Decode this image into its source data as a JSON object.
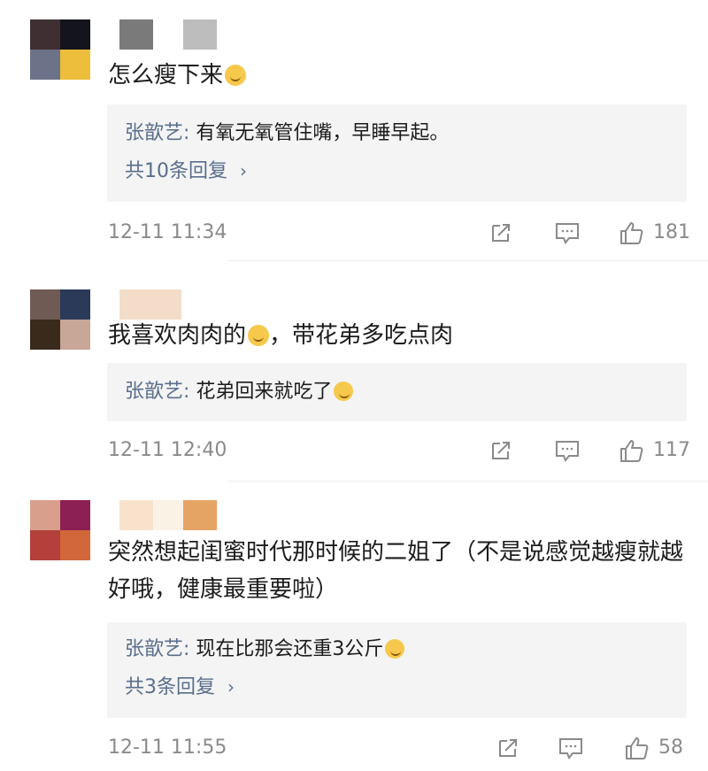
{
  "comments": [
    {
      "text": "怎么瘦下来",
      "emoji": "sad-face-emoji",
      "reply": {
        "name": "张歆艺",
        "sep": ": ",
        "text": "有氧无氧管住嘴，早睡早起。"
      },
      "more": "共10条回复",
      "time": "12-11 11:34",
      "likes": "181"
    },
    {
      "text_before": "我喜欢肉肉的",
      "text_after": "，带花弟多吃点肉",
      "emoji": "shy-face-emoji",
      "reply": {
        "name": "张歆艺",
        "sep": ": ",
        "text": "花弟回来就吃了"
      },
      "reply_emoji": "grin-face-emoji",
      "time": "12-11 12:40",
      "likes": "117"
    },
    {
      "text": "突然想起闺蜜时代那时候的二姐了（不是说感觉越瘦就越好哦，健康最重要啦）",
      "reply": {
        "name": "张歆艺",
        "sep": ": ",
        "text": "现在比那会还重3公斤"
      },
      "reply_emoji": "laugh-cry-emoji",
      "more": "共3条回复",
      "time": "12-11 11:55",
      "likes": "58"
    }
  ],
  "icons": {
    "share": "share-icon",
    "comment": "comment-icon",
    "like": "thumbs-up-icon",
    "chevron": "chevron-right-icon"
  },
  "colors": {
    "reply_name": "#5a6e8c",
    "reply_bg": "#f4f4f4",
    "meta": "#8a8a8a"
  }
}
